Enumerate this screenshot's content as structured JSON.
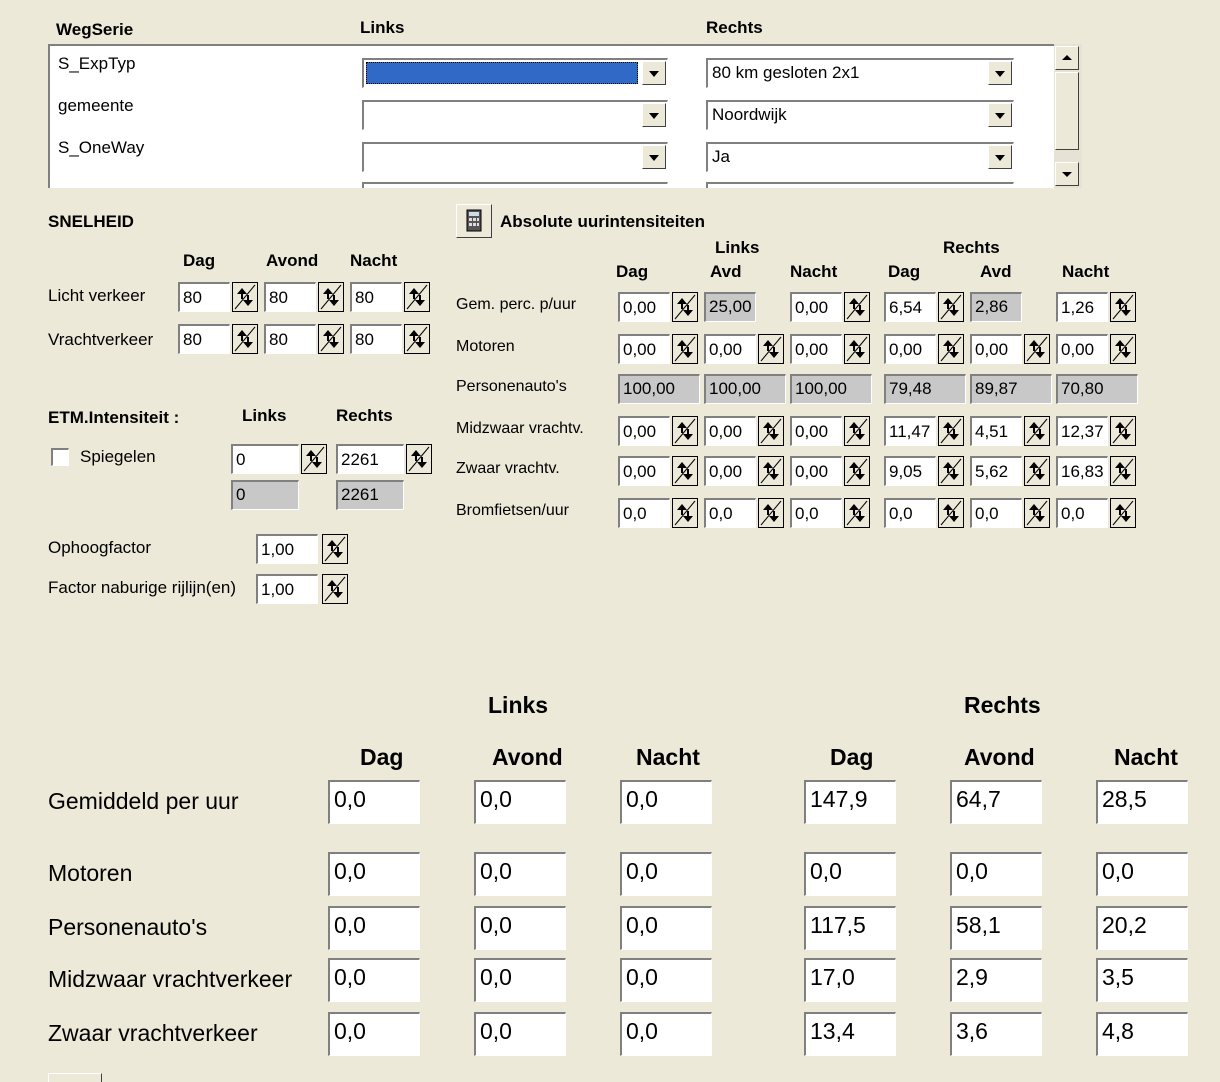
{
  "wegserie": {
    "col_name": "WegSerie",
    "col_left": "Links",
    "col_right": "Rechts",
    "rows": [
      {
        "name": "S_ExpTyp",
        "left": "",
        "right": "80 km gesloten 2x1"
      },
      {
        "name": "gemeente",
        "left": "",
        "right": "Noordwijk"
      },
      {
        "name": "S_OneWay",
        "left": "",
        "right": "Ja"
      }
    ]
  },
  "snelheid": {
    "title": "SNELHEID",
    "col_dag": "Dag",
    "col_avond": "Avond",
    "col_nacht": "Nacht",
    "licht_label": "Licht verkeer",
    "licht": [
      "80",
      "80",
      "80"
    ],
    "vracht_label": "Vrachtverkeer",
    "vracht": [
      "80",
      "80",
      "80"
    ]
  },
  "etm": {
    "title": "ETM.Intensiteit :",
    "col_left": "Links",
    "col_right": "Rechts",
    "spiegelen_label": "Spiegelen",
    "left_value": "0",
    "right_value": "2261",
    "left_readonly": "0",
    "right_readonly": "2261"
  },
  "ophoog": {
    "label": "Ophoogfactor",
    "value": "1,00",
    "naburig_label": "Factor naburige rijlijn(en)",
    "naburig_value": "1,00"
  },
  "abs_uur": {
    "title": "Absolute uurintensiteiten",
    "group_left": "Links",
    "group_right": "Rechts",
    "cols": [
      "Dag",
      "Avd",
      "Nacht",
      "Dag",
      "Avd",
      "Nacht"
    ],
    "rows": [
      {
        "label": "Gem. perc. p/uur",
        "values": [
          "0,00",
          "25,00",
          "0,00",
          "6,54",
          "2,86",
          "1,26"
        ]
      },
      {
        "label": "Motoren",
        "values": [
          "0,00",
          "0,00",
          "0,00",
          "0,00",
          "0,00",
          "0,00"
        ]
      },
      {
        "label": "Personenauto's",
        "values": [
          "100,00",
          "100,00",
          "100,00",
          "79,48",
          "89,87",
          "70,80"
        ]
      },
      {
        "label": "Midzwaar vrachtv.",
        "values": [
          "0,00",
          "0,00",
          "0,00",
          "11,47",
          "4,51",
          "12,37"
        ]
      },
      {
        "label": "Zwaar vrachtv.",
        "values": [
          "0,00",
          "0,00",
          "0,00",
          "9,05",
          "5,62",
          "16,83"
        ]
      },
      {
        "label": "Bromfietsen/uur",
        "values": [
          "0,0",
          "0,0",
          "0,0",
          "0,0",
          "0,0",
          "0,0"
        ]
      }
    ]
  },
  "results": {
    "group_left": "Links",
    "group_right": "Rechts",
    "cols": [
      "Dag",
      "Avond",
      "Nacht",
      "Dag",
      "Avond",
      "Nacht"
    ],
    "rows": [
      {
        "label": "Gemiddeld per uur",
        "values": [
          "0,0",
          "0,0",
          "0,0",
          "147,9",
          "64,7",
          "28,5"
        ]
      },
      {
        "label": "Motoren",
        "values": [
          "0,0",
          "0,0",
          "0,0",
          "0,0",
          "0,0",
          "0,0"
        ]
      },
      {
        "label": "Personenauto's",
        "values": [
          "0,0",
          "0,0",
          "0,0",
          "117,5",
          "58,1",
          "20,2"
        ]
      },
      {
        "label": "Midzwaar vrachtverkeer",
        "values": [
          "0,0",
          "0,0",
          "0,0",
          "17,0",
          "2,9",
          "3,5"
        ]
      },
      {
        "label": "Zwaar vrachtverkeer",
        "values": [
          "0,0",
          "0,0",
          "0,0",
          "13,4",
          "3,6",
          "4,8"
        ]
      }
    ]
  }
}
